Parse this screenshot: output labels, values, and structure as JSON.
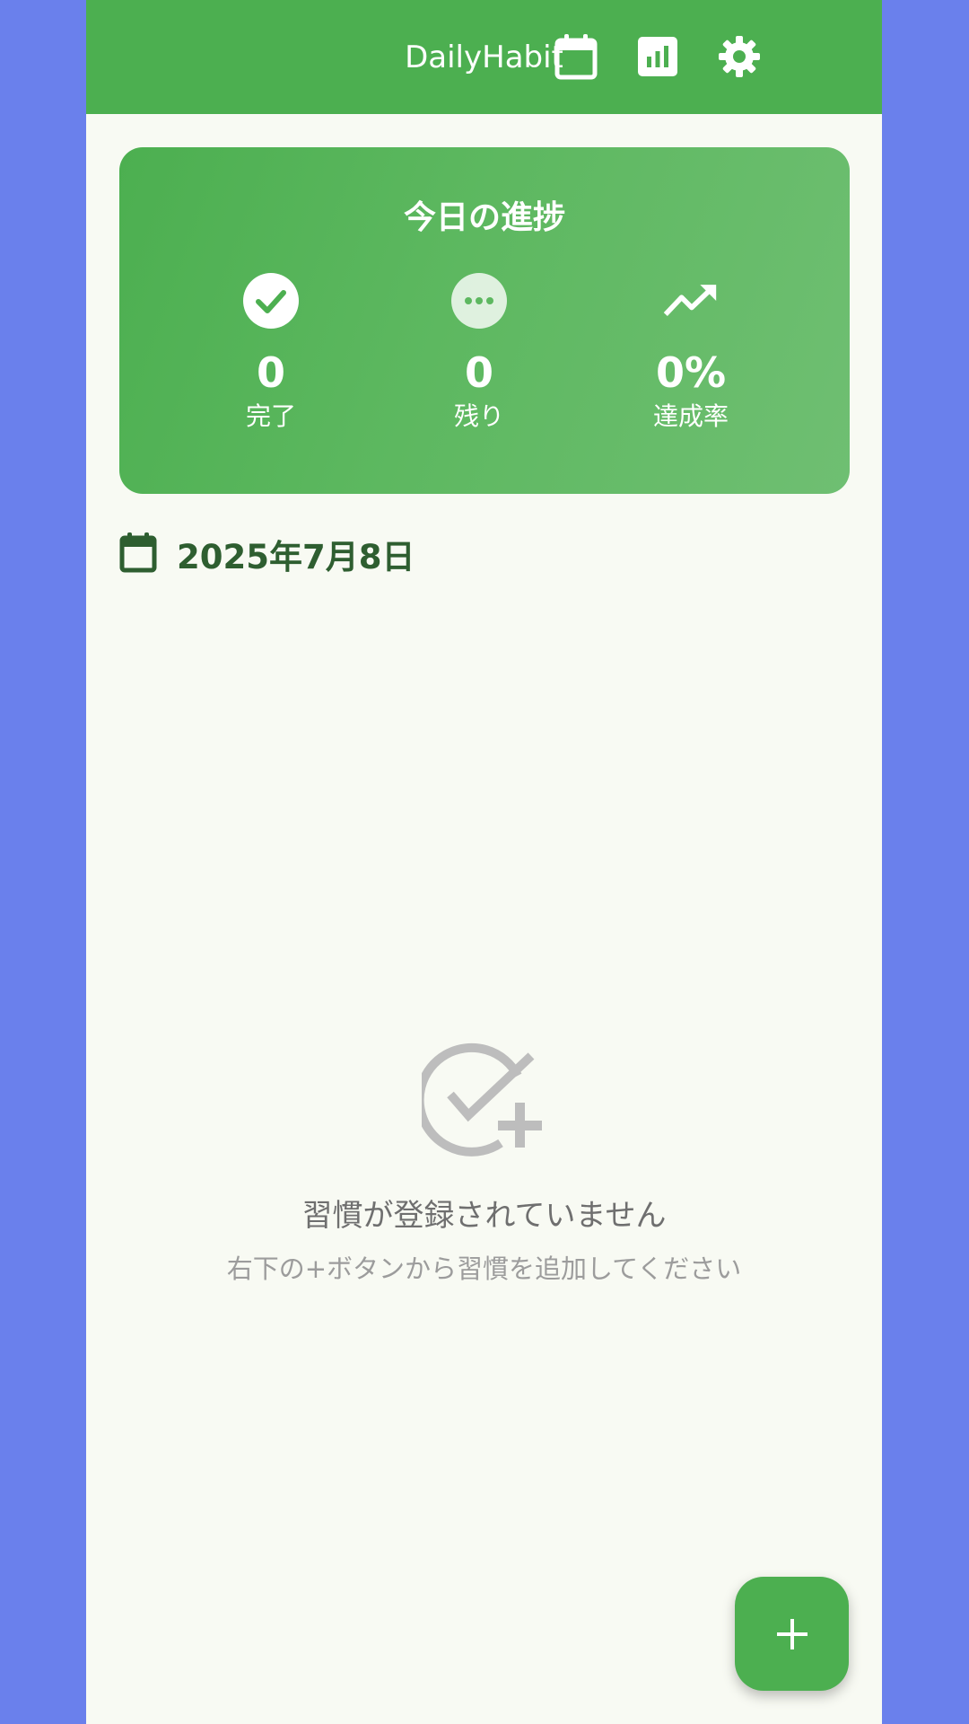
{
  "app": {
    "title": "DailyHabit",
    "primary_color": "#4caf50",
    "background_color": "#f8faf3",
    "outer_background": "#6a80ec"
  },
  "toolbar": {
    "icons": [
      "calendar-icon",
      "bar-chart-icon",
      "settings-gear-icon"
    ]
  },
  "progress_card": {
    "title": "今日の進捗",
    "stats": [
      {
        "icon": "check-circle-icon",
        "value": "0",
        "label": "完了"
      },
      {
        "icon": "more-horiz-circle-icon",
        "value": "0",
        "label": "残り"
      },
      {
        "icon": "trending-up-icon",
        "value": "0%",
        "label": "達成率"
      }
    ]
  },
  "date_section": {
    "icon": "calendar-icon",
    "date": "2025年7月8日"
  },
  "empty_state": {
    "icon": "add-task-icon",
    "title": "習慣が登録されていません",
    "subtitle": "右下の+ボタンから習慣を追加してください"
  },
  "fab": {
    "label": "+",
    "icon": "plus-icon"
  }
}
